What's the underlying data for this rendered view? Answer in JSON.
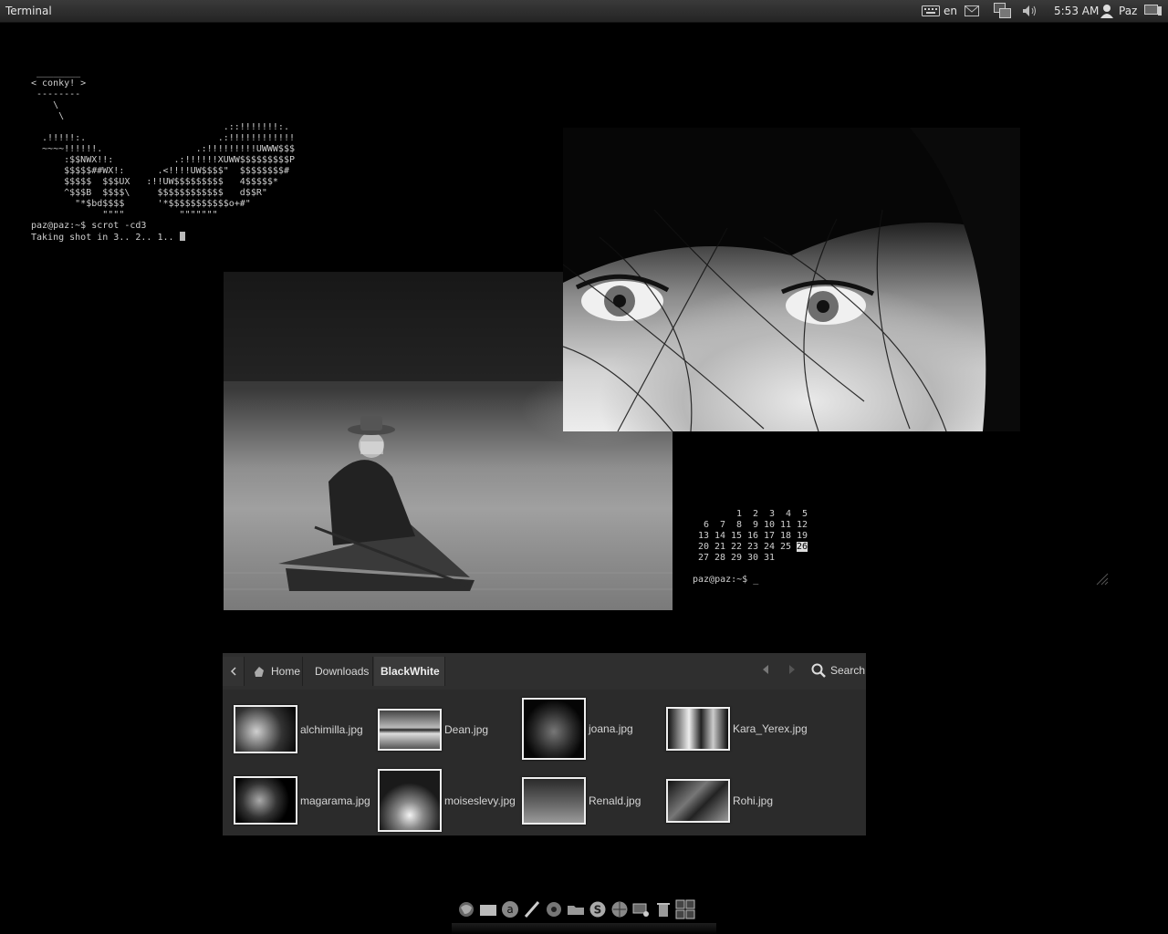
{
  "panel": {
    "app_title": "Terminal",
    "keyboard_layout": "en",
    "clock": "5:53 AM",
    "user": "Paz"
  },
  "terminal": {
    "art_lines": [
      " ________",
      "< conky! >",
      " --------",
      "    \\",
      "     \\",
      "                                   .::!!!!!!!:.",
      "  .!!!!!:.                        .:!!!!!!!!!!!!",
      "  ~~~~!!!!!!.                 .:!!!!!!!!!UWWW$$$",
      "      :$$NWX!!:           .:!!!!!!XUWW$$$$$$$$$P",
      "      $$$$$##WX!:      .<!!!!UW$$$$\"  $$$$$$$$#",
      "      $$$$$  $$$UX   :!!UW$$$$$$$$$   4$$$$$*",
      "      ^$$$B  $$$$\\     $$$$$$$$$$$$   d$$R\"",
      "        \"*$bd$$$$      '*$$$$$$$$$$$o+#\"",
      "             \"\"\"\"          \"\"\"\"\"\"\""
    ],
    "prompt_line": "paz@paz:~$ scrot -cd3",
    "output_line": "Taking shot in 3.. 2.. 1.. "
  },
  "calendar": {
    "rows": [
      [
        "",
        "",
        "1",
        "2",
        "3",
        "4",
        "5"
      ],
      [
        "6",
        "7",
        "8",
        "9",
        "10",
        "11",
        "12"
      ],
      [
        "13",
        "14",
        "15",
        "16",
        "17",
        "18",
        "19"
      ],
      [
        "20",
        "21",
        "22",
        "23",
        "24",
        "25",
        "26"
      ],
      [
        "27",
        "28",
        "29",
        "30",
        "31",
        "",
        ""
      ]
    ],
    "today": "26",
    "prompt": "paz@paz:~$ _"
  },
  "file_manager": {
    "breadcrumbs": [
      "Home",
      "Downloads",
      "BlackWhite"
    ],
    "active_crumb": "BlackWhite",
    "search_label": "Search",
    "files": [
      {
        "name": "alchimilla.jpg"
      },
      {
        "name": "Dean.jpg"
      },
      {
        "name": "joana.jpg"
      },
      {
        "name": "Kara_Yerex.jpg"
      },
      {
        "name": "magarama.jpg"
      },
      {
        "name": "moiseslevy.jpg"
      },
      {
        "name": "Renald.jpg"
      },
      {
        "name": "Rohi.jpg"
      }
    ]
  },
  "dock": {
    "items": [
      "firefox-icon",
      "files-icon",
      "software-center-icon",
      "editor-icon",
      "media-icon",
      "folder-icon",
      "skype-icon",
      "browser-icon",
      "settings-icon",
      "trash-icon",
      "workspaces-icon"
    ]
  }
}
